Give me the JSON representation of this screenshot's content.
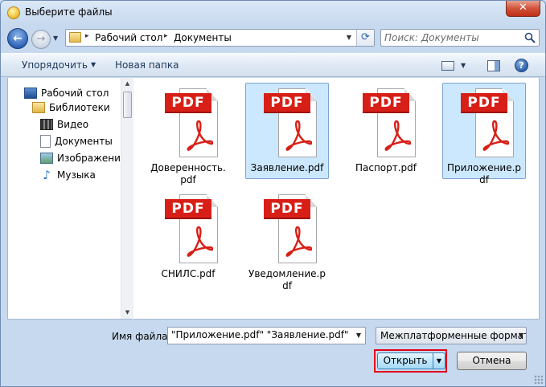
{
  "window": {
    "title": "Выберите файлы",
    "close_glyph": "✕"
  },
  "nav": {
    "back_glyph": "←",
    "forward_glyph": "→",
    "history_glyph": "▼"
  },
  "address": {
    "sep": "▸",
    "segments": [
      "Рабочий стол",
      "Документы"
    ],
    "dropdown_glyph": "▼",
    "refresh_glyph": "⟳"
  },
  "search": {
    "placeholder": "Поиск: Документы"
  },
  "toolbar": {
    "organize_label": "Упорядочить",
    "organize_caret": "▼",
    "new_folder_label": "Новая папка",
    "view_caret": "▼",
    "help_glyph": "?"
  },
  "navpane": {
    "items": [
      {
        "label": "Рабочий стол",
        "icon": "desktop-icon"
      },
      {
        "label": "Библиотеки",
        "icon": "libraries-icon"
      },
      {
        "label": "Видео",
        "icon": "video-icon"
      },
      {
        "label": "Документы",
        "icon": "documents-icon"
      },
      {
        "label": "Изображения",
        "icon": "images-icon"
      },
      {
        "label": "Музыка",
        "icon": "music-icon",
        "glyph": "♪"
      }
    ],
    "scroll_up": "▲",
    "scroll_down": "▼"
  },
  "files": {
    "badge": "PDF",
    "items": [
      {
        "name": "Доверенность.pdf",
        "selected": false
      },
      {
        "name": "Заявление.pdf",
        "selected": true
      },
      {
        "name": "Паспорт.pdf",
        "selected": false
      },
      {
        "name": "Приложение.pdf",
        "selected": true
      },
      {
        "name": "СНИЛС.pdf",
        "selected": false
      },
      {
        "name": "Уведомление.pdf",
        "selected": false
      }
    ]
  },
  "footer": {
    "filename_label": "Имя файла:",
    "filename_value": "\"Приложение.pdf\" \"Заявление.pdf\"",
    "filename_caret": "▼",
    "filter_value": "Межплатформенные формат",
    "filter_caret": "▼",
    "open_label": "Открыть",
    "open_caret": "▼",
    "cancel_label": "Отмена"
  },
  "colors": {
    "accent": "#3c7fb1",
    "highlight": "#e4001b",
    "pdf_red": "#d81f17",
    "selection": "#cce8ff"
  }
}
